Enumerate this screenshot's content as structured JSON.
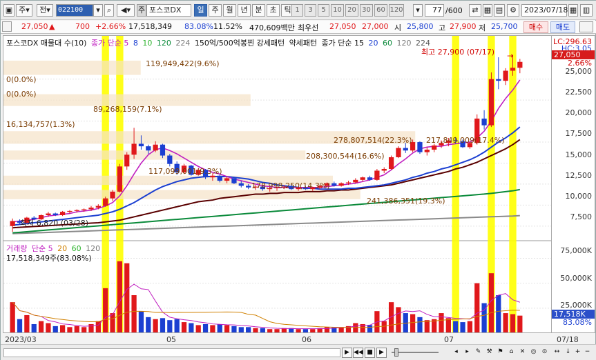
{
  "toolbar": {
    "type_label": "주",
    "prev_label": "전",
    "code": "022100",
    "stock_prefix": "주",
    "stock_name": "포스코DX",
    "periods": [
      "일",
      "주",
      "월",
      "년",
      "분",
      "초",
      "틱"
    ],
    "active_period": "일",
    "intervals": [
      "1",
      "3",
      "5",
      "10",
      "20",
      "30",
      "60",
      "120"
    ],
    "count": "77",
    "count_total": "/600",
    "date": "2023/07/18"
  },
  "quote": {
    "price": "27,050",
    "arrow": "▲",
    "change": "700",
    "change_pct": "+2.66%",
    "volume": "17,518,349",
    "vol_ratio": "83.08%",
    "turnover": "11.52%",
    "amount": "470,609백만",
    "best_label": "최우선",
    "ask": "27,050",
    "bid": "27,000",
    "open_label": "시",
    "open": "25,800",
    "high_label": "고",
    "high": "27,900",
    "low_label": "저",
    "low": "25,700",
    "buy_label": "매수",
    "sell_label": "매도"
  },
  "price_legend": {
    "name": "포스코DX 매물대 수(10)",
    "ma_label": "종가 단순 5",
    "ma_periods": [
      "8",
      "10",
      "120",
      "224"
    ],
    "pattern1": "150억/500억봉찐 강세패턴",
    "pattern2": "약세패턴",
    "ma2_label": "종가 단순 15",
    "ma2_periods": [
      "20",
      "60",
      "120",
      "224"
    ]
  },
  "annotations": {
    "high": "최고 27,900 (07/17)",
    "low": "최저 6,820 (03/28)",
    "vp": [
      "119,949,422(9.6%)",
      "0(0.0%)",
      "0(0.0%)",
      "89,268,159(7.1%)",
      "16,134,757(1.3%)",
      "278,807,514(22.3%)",
      "208,300,544(16.6%)",
      "178,998,250(14.3%)",
      "241,386,351(19.3%)",
      "117,099,001(9.3%)",
      "217,849,009(17.4%)"
    ],
    "lc": "LC:296.63",
    "hc": "HC:3.05"
  },
  "y_axis": {
    "price_ticks": [
      "25,000",
      "22,500",
      "20,000",
      "17,500",
      "15,000",
      "12,500",
      "10,000",
      "7,500"
    ],
    "price_tag": "27,050",
    "price_pct": "2.66%",
    "vol_ticks": [
      "75,000K",
      "50,000K",
      "25,000K"
    ],
    "vol_tag": "17,518K",
    "vol_pct": "83.08%"
  },
  "volume_legend": {
    "name": "거래량",
    "ma_label": "단순 5",
    "periods": [
      "20",
      "60",
      "120"
    ],
    "value": "17,518,349주(83.08%)"
  },
  "x_axis": {
    "labels": [
      "2023/03",
      "05",
      "06",
      "07"
    ],
    "right_label": "07/18"
  },
  "colors": {
    "up": "#e0181b",
    "down": "#1b3fd1",
    "highlight": "#ffff00",
    "vp": "#f5e3c8"
  },
  "chart_data": {
    "type": "candlestick",
    "ylim": [
      6500,
      29000
    ],
    "vol_max": 85000,
    "candles": [
      [
        7500,
        8400,
        6820,
        8100,
        31000
      ],
      [
        8100,
        8300,
        7700,
        7900,
        14000
      ],
      [
        7900,
        8600,
        7800,
        8500,
        18000
      ],
      [
        8500,
        8700,
        8200,
        8300,
        9000
      ],
      [
        8300,
        8900,
        8200,
        8800,
        12000
      ],
      [
        8800,
        9200,
        8600,
        9000,
        10000
      ],
      [
        9000,
        9100,
        8700,
        8800,
        7000
      ],
      [
        8800,
        9300,
        8700,
        9200,
        8000
      ],
      [
        9200,
        9400,
        9000,
        9300,
        6000
      ],
      [
        9300,
        9500,
        9100,
        9400,
        7000
      ],
      [
        9400,
        9600,
        9200,
        9500,
        6000
      ],
      [
        9500,
        9900,
        9300,
        9700,
        9000
      ],
      [
        9700,
        10100,
        9500,
        9900,
        12000
      ],
      [
        9900,
        11000,
        9800,
        10800,
        45000
      ],
      [
        10800,
        11800,
        10500,
        11600,
        20000
      ],
      [
        11600,
        14900,
        11500,
        14600,
        72000
      ],
      [
        14600,
        16300,
        14200,
        16000,
        70000
      ],
      [
        16000,
        19200,
        15500,
        17300,
        38000
      ],
      [
        17300,
        18300,
        16600,
        17000,
        22000
      ],
      [
        17000,
        17200,
        16100,
        16500,
        16000
      ],
      [
        16500,
        17600,
        16300,
        17200,
        14000
      ],
      [
        17200,
        17300,
        15600,
        15900,
        15000
      ],
      [
        15900,
        16100,
        14600,
        14900,
        13000
      ],
      [
        14900,
        15200,
        13600,
        13900,
        14000
      ],
      [
        13900,
        14900,
        13700,
        14700,
        11000
      ],
      [
        14700,
        14800,
        13500,
        13600,
        10000
      ],
      [
        13600,
        14400,
        13500,
        14200,
        8000
      ],
      [
        14200,
        14300,
        13100,
        13300,
        9000
      ],
      [
        13300,
        13800,
        12900,
        13500,
        8000
      ],
      [
        13500,
        13600,
        12700,
        12900,
        9000
      ],
      [
        12900,
        13400,
        12600,
        13200,
        8000
      ],
      [
        13200,
        13300,
        12500,
        12600,
        7000
      ],
      [
        12600,
        12900,
        12100,
        12300,
        6000
      ],
      [
        12300,
        12500,
        11900,
        12100,
        6000
      ],
      [
        12100,
        12400,
        11800,
        12200,
        5000
      ],
      [
        12200,
        12300,
        11700,
        11900,
        5000
      ],
      [
        11900,
        12200,
        11600,
        12000,
        4000
      ],
      [
        12000,
        12300,
        11700,
        12100,
        4000
      ],
      [
        12100,
        12400,
        11900,
        12200,
        5000
      ],
      [
        12200,
        12500,
        11800,
        11900,
        5000
      ],
      [
        11900,
        12200,
        11700,
        12100,
        4000
      ],
      [
        12100,
        12300,
        11800,
        11900,
        4000
      ],
      [
        11900,
        12200,
        11700,
        12100,
        4000
      ],
      [
        12100,
        12400,
        11900,
        12300,
        5000
      ],
      [
        12300,
        12700,
        12100,
        12600,
        6000
      ],
      [
        12600,
        12800,
        12200,
        12300,
        6000
      ],
      [
        12300,
        12700,
        12200,
        12600,
        6000
      ],
      [
        12600,
        12900,
        12400,
        12700,
        7000
      ],
      [
        12700,
        13200,
        12600,
        13000,
        10000
      ],
      [
        13000,
        13400,
        12800,
        13300,
        9000
      ],
      [
        13300,
        13500,
        12900,
        13000,
        8000
      ],
      [
        13000,
        14300,
        12900,
        14100,
        22000
      ],
      [
        14100,
        14500,
        13800,
        14300,
        12000
      ],
      [
        14300,
        15900,
        14200,
        15700,
        31000
      ],
      [
        15700,
        17000,
        15600,
        16800,
        26000
      ],
      [
        16800,
        17400,
        16200,
        16500,
        20000
      ],
      [
        16500,
        17800,
        16300,
        17500,
        19000
      ],
      [
        17500,
        17600,
        16100,
        16300,
        16000
      ],
      [
        16300,
        16900,
        15900,
        16600,
        13000
      ],
      [
        16600,
        17300,
        16300,
        17100,
        14000
      ],
      [
        17100,
        17700,
        16800,
        17400,
        20000
      ],
      [
        17400,
        18000,
        17000,
        17700,
        15000
      ],
      [
        17700,
        18100,
        17300,
        17600,
        12000
      ],
      [
        17600,
        17800,
        16800,
        16900,
        11000
      ],
      [
        16900,
        17600,
        16700,
        17400,
        12000
      ],
      [
        17400,
        20800,
        17200,
        20300,
        50000
      ],
      [
        20300,
        21300,
        19000,
        19500,
        30000
      ],
      [
        19500,
        25800,
        19300,
        25000,
        60000
      ],
      [
        25000,
        27600,
        23800,
        24800,
        38000
      ],
      [
        24800,
        26300,
        24300,
        26000,
        20000
      ],
      [
        26000,
        27900,
        25400,
        26350,
        19000
      ],
      [
        26350,
        27400,
        25700,
        27050,
        17518
      ]
    ],
    "ma5": [
      8000,
      8100,
      8200,
      8300,
      8500,
      8700,
      8800,
      8900,
      9000,
      9200,
      9300,
      9400,
      9600,
      9900,
      10300,
      11100,
      12300,
      13700,
      15000,
      16000,
      16600,
      16800,
      16500,
      16100,
      15600,
      15100,
      14600,
      14200,
      13900,
      13700,
      13400,
      13100,
      12900,
      12700,
      12500,
      12300,
      12200,
      12100,
      12100,
      12100,
      12100,
      12100,
      12100,
      12100,
      12200,
      12300,
      12400,
      12500,
      12600,
      12800,
      13000,
      13300,
      13600,
      14200,
      14900,
      15500,
      16200,
      16700,
      16900,
      17000,
      17000,
      17200,
      17300,
      17400,
      17500,
      18000,
      18800,
      20000,
      21500,
      22700,
      23700,
      24900
    ],
    "ma20": [
      7600,
      7700,
      7800,
      7900,
      8000,
      8100,
      8200,
      8300,
      8400,
      8500,
      8600,
      8700,
      8800,
      9000,
      9200,
      9500,
      9900,
      10300,
      10800,
      11300,
      11800,
      12200,
      12500,
      12800,
      13000,
      13200,
      13300,
      13400,
      13400,
      13400,
      13400,
      13300,
      13200,
      13100,
      12900,
      12700,
      12600,
      12400,
      12300,
      12200,
      12100,
      12000,
      12000,
      11900,
      11900,
      11900,
      11900,
      12000,
      12000,
      12100,
      12200,
      12300,
      12400,
      12600,
      12800,
      13000,
      13300,
      13500,
      13800,
      14000,
      14300,
      14500,
      14800,
      15100,
      15400,
      15800,
      16300,
      16900,
      17500,
      18000,
      18600,
      19300
    ],
    "ma60": [
      7300,
      7350,
      7400,
      7450,
      7500,
      7550,
      7600,
      7650,
      7700,
      7750,
      7800,
      7850,
      7900,
      8000,
      8100,
      8200,
      8400,
      8600,
      8800,
      9000,
      9200,
      9400,
      9600,
      9800,
      10000,
      10200,
      10400,
      10500,
      10600,
      10800,
      10900,
      11000,
      11100,
      11200,
      11300,
      11300,
      11400,
      11400,
      11500,
      11500,
      11500,
      11600,
      11600,
      11600,
      11700,
      11700,
      11800,
      11800,
      11900,
      12000,
      12100,
      12200,
      12300,
      12400,
      12600,
      12800,
      13000,
      13200,
      13400,
      13600,
      13800,
      14000,
      14300,
      14500,
      14800,
      15100,
      15500,
      15900,
      16300,
      16700,
      17200,
      17800
    ],
    "ma120": [
      6700,
      6760,
      6830,
      6900,
      6970,
      7040,
      7110,
      7180,
      7250,
      7320,
      7390,
      7460,
      7530,
      7600,
      7670,
      7740,
      7810,
      7880,
      7950,
      8020,
      8090,
      8160,
      8230,
      8300,
      8370,
      8440,
      8510,
      8580,
      8650,
      8720,
      8790,
      8860,
      8930,
      9000,
      9070,
      9140,
      9210,
      9280,
      9350,
      9420,
      9490,
      9560,
      9630,
      9700,
      9770,
      9840,
      9910,
      9980,
      10050,
      10120,
      10190,
      10260,
      10330,
      10400,
      10470,
      10540,
      10610,
      10680,
      10750,
      10820,
      10890,
      10960,
      11030,
      11100,
      11170,
      11240,
      11310,
      11400,
      11500,
      11600,
      11700,
      11850
    ],
    "ma224": [
      6600,
      6630,
      6660,
      6690,
      6720,
      6750,
      6780,
      6810,
      6840,
      6870,
      6900,
      6930,
      6960,
      6990,
      7020,
      7050,
      7080,
      7110,
      7140,
      7170,
      7200,
      7230,
      7260,
      7290,
      7320,
      7350,
      7380,
      7410,
      7440,
      7470,
      7500,
      7530,
      7560,
      7590,
      7620,
      7650,
      7680,
      7710,
      7740,
      7770,
      7800,
      7830,
      7860,
      7890,
      7920,
      7950,
      7980,
      8010,
      8040,
      8070,
      8100,
      8130,
      8160,
      8190,
      8220,
      8250,
      8280,
      8310,
      8340,
      8370,
      8400,
      8430,
      8460,
      8490,
      8520,
      8550,
      8580,
      8610,
      8640,
      8670,
      8700,
      8750
    ]
  }
}
